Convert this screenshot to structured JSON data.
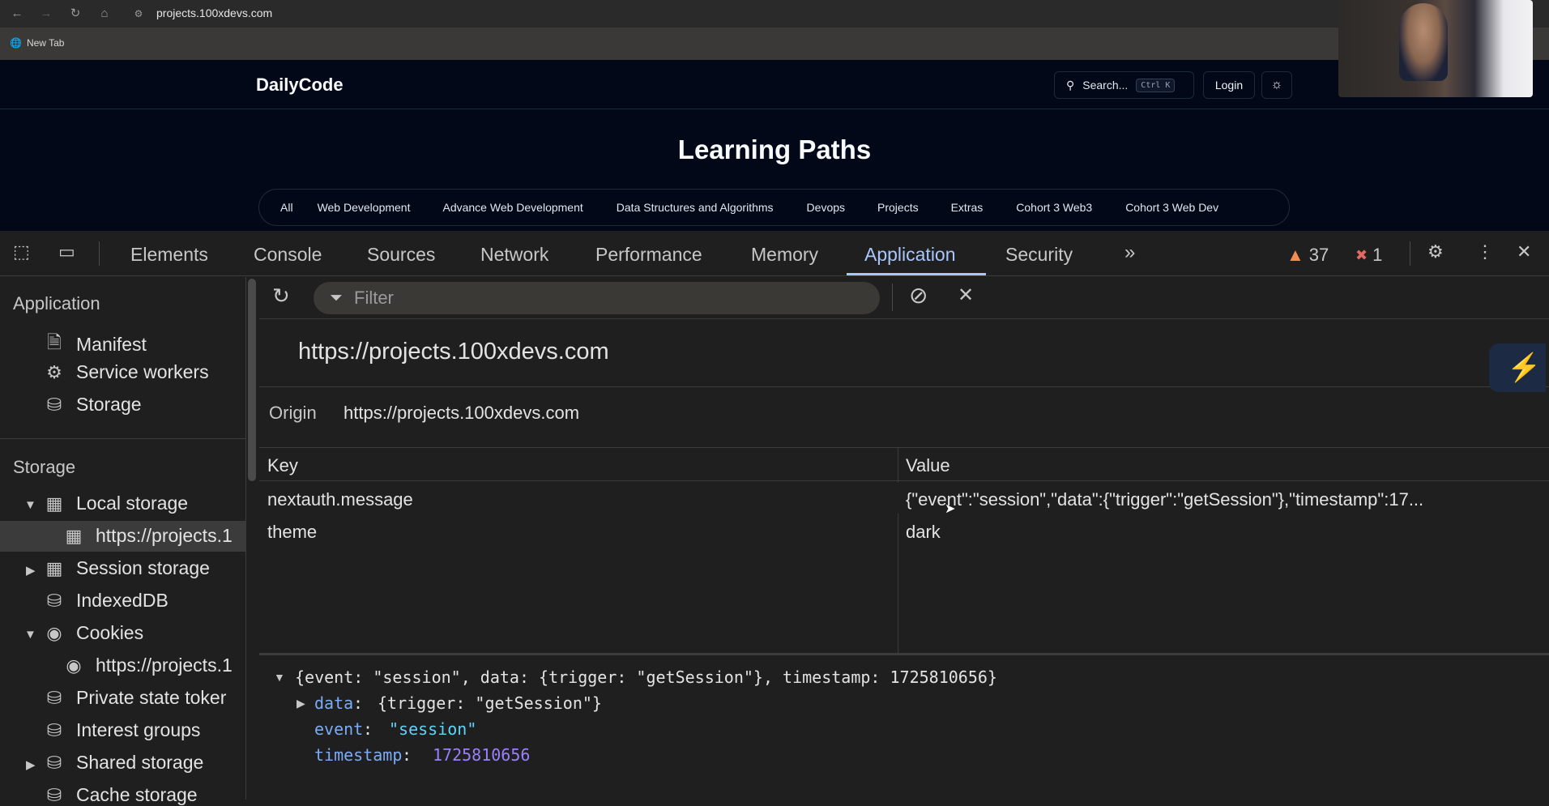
{
  "browser": {
    "url": "projects.100xdevs.com",
    "bookmark_newtab": "New Tab"
  },
  "site": {
    "logo": "DailyCode",
    "search_label": "Search...",
    "search_shortcut": "Ctrl K",
    "login_label": "Login",
    "page_title": "Learning Paths",
    "paths": [
      "All",
      "Web Development",
      "Advance Web Development",
      "Data Structures and Algorithms",
      "Devops",
      "Projects",
      "Extras",
      "Cohort 3 Web3",
      "Cohort 3 Web Dev"
    ]
  },
  "devtools": {
    "tabs": {
      "elements": "Elements",
      "console": "Console",
      "sources": "Sources",
      "network": "Network",
      "performance": "Performance",
      "memory": "Memory",
      "application": "Application",
      "security": "Security"
    },
    "warnings_count": "37",
    "errors_count": "1",
    "sidebar": {
      "application_heading": "Application",
      "manifest": "Manifest",
      "service_workers": "Service workers",
      "storage": "Storage",
      "storage_heading": "Storage",
      "local_storage": "Local storage",
      "local_storage_origin": "https://projects.1",
      "session_storage": "Session storage",
      "indexeddb": "IndexedDB",
      "cookies": "Cookies",
      "cookies_origin": "https://projects.1",
      "private_state_tokens": "Private state toker",
      "interest_groups": "Interest groups",
      "shared_storage": "Shared storage",
      "cache_storage": "Cache storage"
    },
    "filter_placeholder": "Filter",
    "origin_title": "https://projects.100xdevs.com",
    "origin_label": "Origin",
    "origin_value": "https://projects.100xdevs.com",
    "table": {
      "key_header": "Key",
      "value_header": "Value",
      "rows": [
        {
          "key": "nextauth.message",
          "value": "{\"event\":\"session\",\"data\":{\"trigger\":\"getSession\"},\"timestamp\":17..."
        },
        {
          "key": "theme",
          "value": "dark"
        }
      ]
    },
    "preview": {
      "summary": "{event: \"session\", data: {trigger: \"getSession\"}, timestamp: 1725810656}",
      "data_key": "data",
      "data_value": "{trigger: \"getSession\"}",
      "event_key": "event",
      "event_value": "\"session\"",
      "timestamp_key": "timestamp",
      "timestamp_value": "1725810656"
    }
  },
  "colors": {
    "accent": "#a8c7fa",
    "page_bg": "#020817",
    "devtools_bg": "#1f1f1f",
    "warning": "#f28b54",
    "error": "#e46962"
  }
}
